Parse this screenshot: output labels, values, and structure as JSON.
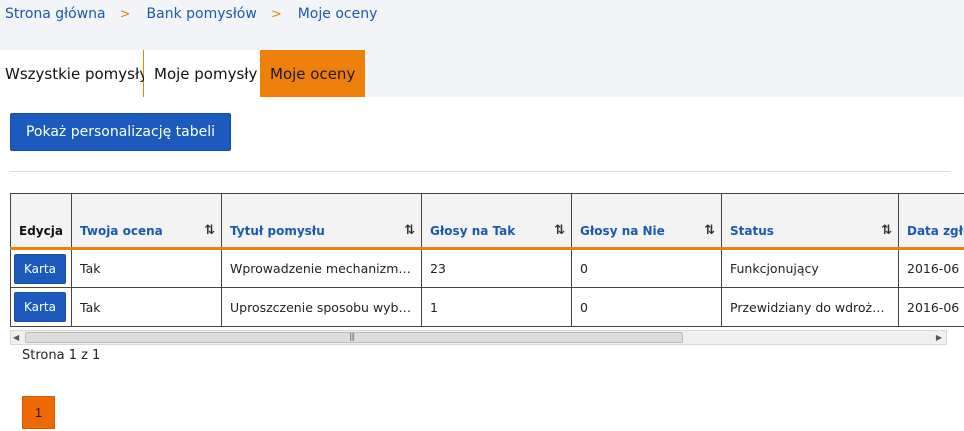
{
  "breadcrumb": {
    "items": [
      "Strona główna",
      "Bank pomysłów",
      "Moje oceny"
    ],
    "separator": ">"
  },
  "tabs": [
    {
      "label": "Wszystkie pomysły",
      "active": false
    },
    {
      "label": "Moje pomysły",
      "active": false
    },
    {
      "label": "Moje oceny",
      "active": true
    }
  ],
  "toolbar": {
    "personalize_label": "Pokaż personalizację tabeli"
  },
  "table": {
    "columns": [
      "Edycja",
      "Twoja ocena",
      "Tytuł pomysłu",
      "Głosy na Tak",
      "Głosy na Nie",
      "Status",
      "Data zgłoszenia"
    ],
    "sort_icon": "⇅",
    "edit_button_label": "Karta",
    "rows": [
      {
        "rating": "Tak",
        "title": "Wprowadzenie mechanizmu informowania",
        "yes": "23",
        "no": "0",
        "status": "Funkcjonujący",
        "date": "2016-06"
      },
      {
        "rating": "Tak",
        "title": "Uproszczenie sposobu wyboru",
        "yes": "1",
        "no": "0",
        "status": "Przewidziany do wdrożenia",
        "date": "2016-06"
      }
    ]
  },
  "pagination": {
    "info": "Strona 1 z 1",
    "current_page": "1"
  },
  "colors": {
    "accent": "#ee7f0b",
    "primary": "#1c5bbd",
    "link": "#1b59b1"
  }
}
